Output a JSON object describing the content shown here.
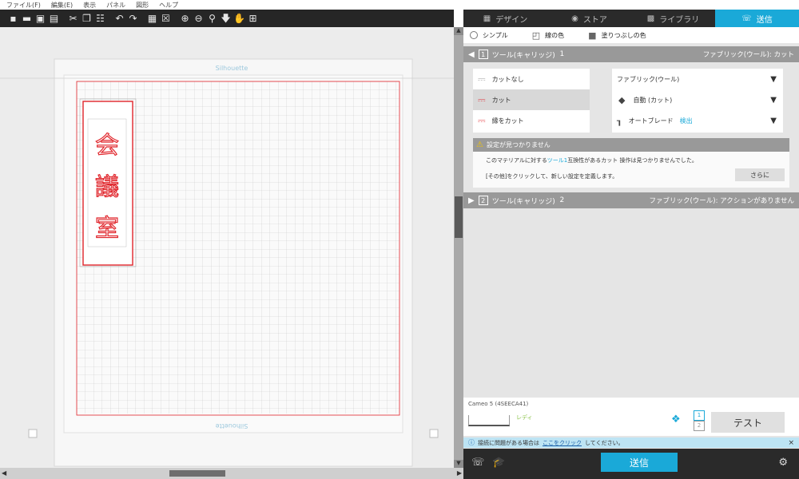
{
  "menu": [
    "ファイル(F)",
    "編集(E)",
    "表示",
    "パネル",
    "図形",
    "ヘルプ"
  ],
  "tabs": [
    {
      "label": "デザイン",
      "icon": "design-grid-icon"
    },
    {
      "label": "ストア",
      "icon": "store-icon"
    },
    {
      "label": "ライブラリ",
      "icon": "library-icon"
    },
    {
      "label": "送信",
      "icon": "send-icon"
    }
  ],
  "modes": {
    "simple": "シンプル",
    "line": "線の色",
    "fill": "塗りつぶしの色"
  },
  "tool1": {
    "number": "1",
    "label": "ツール(キャリッジ)",
    "index": "1",
    "right": "ファブリック(ウール): カット"
  },
  "actions": {
    "none": "カットなし",
    "cut": "カット",
    "perforate": "縁をカット"
  },
  "settings": {
    "material": "ファブリック(ウール)",
    "auto": "自動 (カット)",
    "blade": "オートブレード",
    "blade_status": "検出"
  },
  "warning": {
    "title": "設定が見つかりません",
    "line1_a": "このマテリアルに対する",
    "line1_b": "ツール1",
    "line1_c": "互換性があるカット 操作は見つかりませんでした。",
    "line2": "[その他]をクリックして、新しい設定を定義します。",
    "more": "さらに"
  },
  "tool2": {
    "number": "2",
    "label": "ツール(キャリッジ)",
    "index": "2",
    "right": "ファブリック(ウール): アクションがありません"
  },
  "device": {
    "name": "Cameo 5 (4SEECA41)",
    "status": "レディ",
    "test": "テスト"
  },
  "info": {
    "before": "接続に問題がある場合は",
    "link": "ここをクリック",
    "after": "してください。",
    "close": "×"
  },
  "send": "送信",
  "watermark": "Silhouette",
  "artwork": [
    "会",
    "議",
    "室"
  ],
  "colors": {
    "accent": "#1aa9d8",
    "cutline": "#e0252b",
    "toolbar": "#262626"
  }
}
